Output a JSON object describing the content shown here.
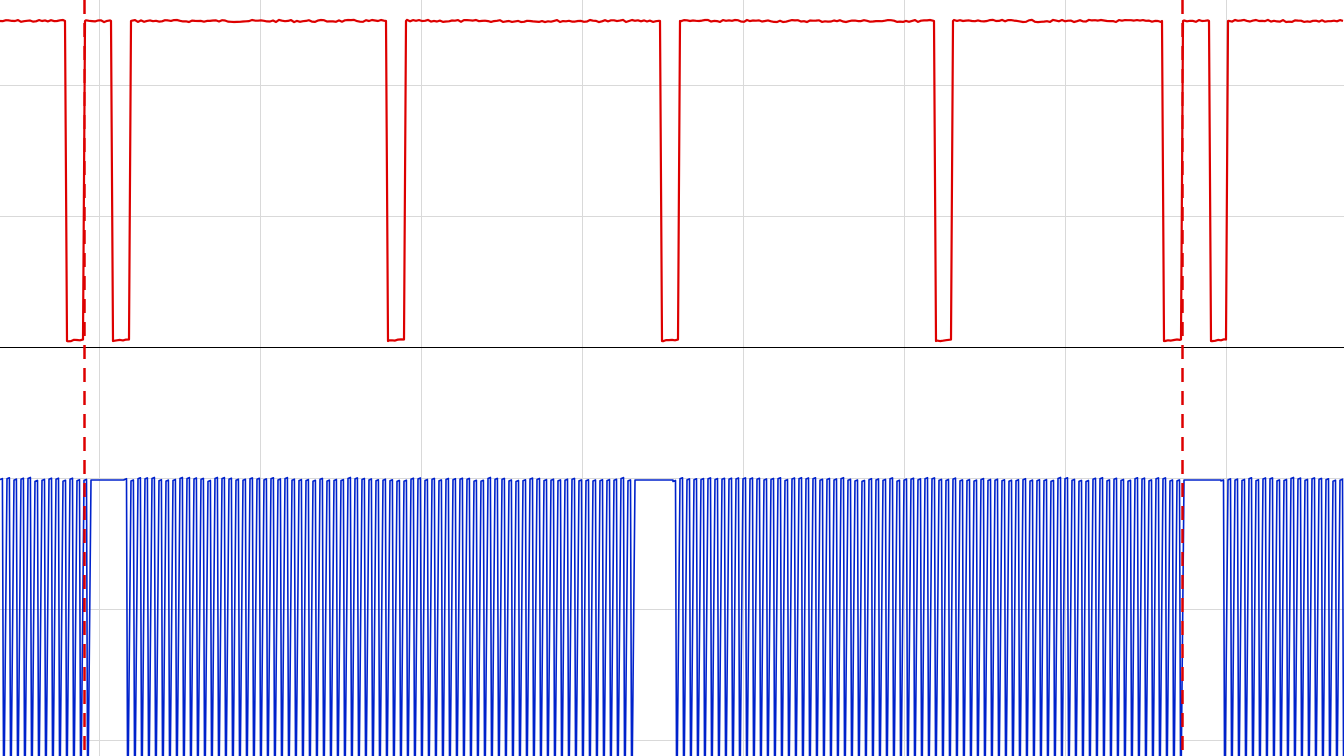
{
  "chart_data": {
    "type": "line",
    "title": "",
    "xlabel": "",
    "ylabel": "",
    "grid": true,
    "legend": "none",
    "series": [
      {
        "color": "#dd0000",
        "high_level": 1,
        "low_level": 0,
        "low_pulses": [
          [
            65,
            85
          ],
          [
            111,
            131
          ],
          [
            386,
            406
          ],
          [
            660,
            680
          ],
          [
            934,
            953
          ],
          [
            1162,
            1183
          ],
          [
            1209,
            1228
          ]
        ]
      },
      {
        "color": "#0022cc",
        "carrier_period": 7.0,
        "gaps": [
          [
            85,
            124
          ],
          [
            634,
            673
          ],
          [
            1182,
            1221
          ]
        ]
      }
    ],
    "cursors": [
      84,
      1182
    ],
    "cursor_color": "#dd0000",
    "x_range": [
      0,
      1344
    ],
    "colors": {
      "grid": "#d9d9d9",
      "baseline": "#000000",
      "background": "#ffffff"
    }
  }
}
